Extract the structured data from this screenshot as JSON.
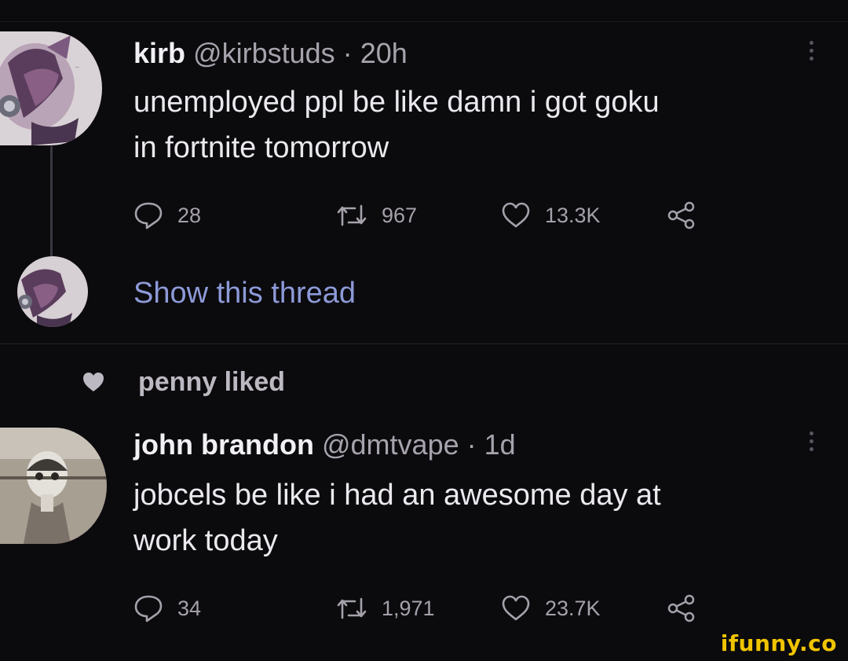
{
  "tweet1": {
    "name": "kirb",
    "handle": "@kirbstuds",
    "separator": "·",
    "time": "20h",
    "text_line1": "unemployed ppl be like damn i got goku",
    "text_line2": "in fortnite tomorrow",
    "replies": "28",
    "retweets": "967",
    "likes": "13.3K"
  },
  "thread": {
    "show_label": "Show this thread"
  },
  "liked_context": {
    "text": "penny liked"
  },
  "tweet2": {
    "name": "john brandon",
    "handle": "@dmtvape",
    "separator": "·",
    "time": "1d",
    "text_line1": "jobcels be like i had an awesome day at",
    "text_line2": "work today",
    "replies": "34",
    "retweets": "1,971",
    "likes": "23.7K"
  },
  "icons": {
    "reply": "reply-icon",
    "retweet": "retweet-icon",
    "like": "heart-icon",
    "share": "share-icon",
    "more": "more-options-icon"
  },
  "colors": {
    "background": "#0b0a0d",
    "link": "#8d9ad8",
    "muted": "#a5a1ab",
    "watermark": "#f0c400"
  },
  "watermark": "ifunny.co"
}
